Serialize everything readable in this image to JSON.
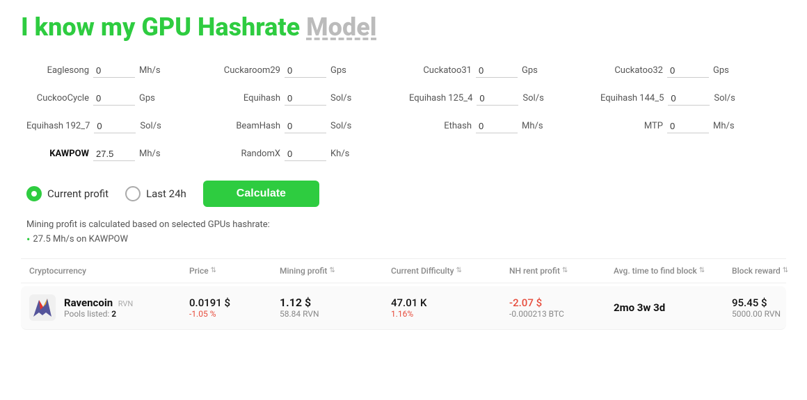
{
  "title": {
    "green_part": "I know my GPU Hashrate",
    "gray_part": "Model"
  },
  "hashrates": [
    {
      "label": "Eaglesong",
      "value": "0",
      "unit": "Mh/s",
      "bold": false
    },
    {
      "label": "Cuckaroom29",
      "value": "0",
      "unit": "Gps",
      "bold": false
    },
    {
      "label": "Cuckatoo31",
      "value": "0",
      "unit": "Gps",
      "bold": false
    },
    {
      "label": "Cuckatoo32",
      "value": "0",
      "unit": "Gps",
      "bold": false
    },
    {
      "label": "CuckooCycle",
      "value": "0",
      "unit": "Gps",
      "bold": false
    },
    {
      "label": "Equihash",
      "value": "0",
      "unit": "Sol/s",
      "bold": false
    },
    {
      "label": "Equihash 125_4",
      "value": "0",
      "unit": "Sol/s",
      "bold": false
    },
    {
      "label": "Equihash 144_5",
      "value": "0",
      "unit": "Sol/s",
      "bold": false
    },
    {
      "label": "Equihash 192_7",
      "value": "0",
      "unit": "Sol/s",
      "bold": false
    },
    {
      "label": "BeamHash",
      "value": "0",
      "unit": "Sol/s",
      "bold": false
    },
    {
      "label": "Ethash",
      "value": "0",
      "unit": "Mh/s",
      "bold": false
    },
    {
      "label": "MTP",
      "value": "0",
      "unit": "Mh/s",
      "bold": false
    },
    {
      "label": "KAWPOW",
      "value": "27.5",
      "unit": "Mh/s",
      "bold": true
    },
    {
      "label": "RandomX",
      "value": "0",
      "unit": "Kh/s",
      "bold": false
    }
  ],
  "controls": {
    "profit_mode_1": "Current profit",
    "profit_mode_2": "Last 24h",
    "calculate_label": "Calculate",
    "active_mode": "current"
  },
  "info": {
    "description": "Mining profit is calculated based on selected GPUs hashrate:",
    "hashrate_detail": "27.5 Mh/s on KAWPOW"
  },
  "table": {
    "headers": [
      {
        "label": "Cryptocurrency",
        "sortable": false
      },
      {
        "label": "Price",
        "sortable": true
      },
      {
        "label": "Mining profit",
        "sortable": true
      },
      {
        "label": "Current Difficulty",
        "sortable": true
      },
      {
        "label": "NH rent profit",
        "sortable": true
      },
      {
        "label": "Avg. time to find block",
        "sortable": true
      },
      {
        "label": "Block reward",
        "sortable": true
      }
    ],
    "rows": [
      {
        "coin_name": "Ravencoin",
        "coin_ticker": "RVN",
        "pools_label": "Pools listed:",
        "pools_count": "2",
        "price": "0.0191 $",
        "price_change": "-1.05 %",
        "profit": "1.12 $",
        "profit_sub": "58.84 RVN",
        "difficulty": "47.01 K",
        "difficulty_sub": "1.16%",
        "nh_profit": "-2.07 $",
        "nh_sub": "-0.000213 BTC",
        "time": "2mo 3w 3d",
        "reward": "95.45 $",
        "reward_sub": "5000.00 RVN"
      }
    ]
  }
}
